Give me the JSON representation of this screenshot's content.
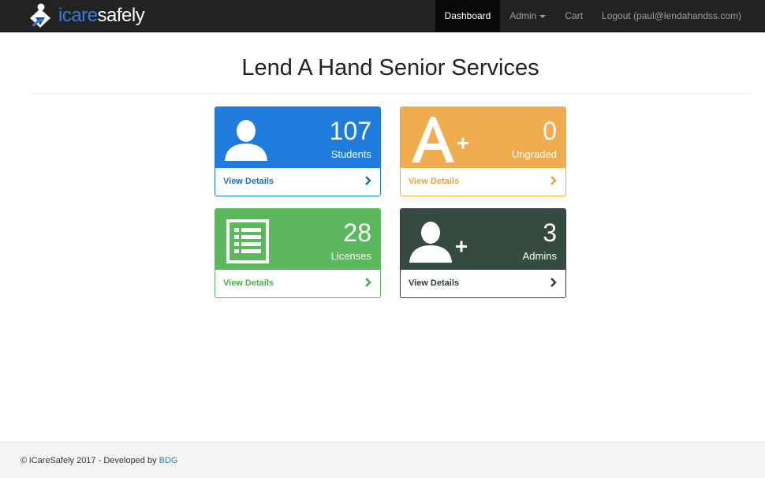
{
  "brand": {
    "name_prefix": "icare",
    "name_suffix": "safely"
  },
  "nav": {
    "dashboard": "Dashboard",
    "admin": "Admin",
    "cart": "Cart",
    "logout": "Logout (paul@lendahandss.com)"
  },
  "page": {
    "title": "Lend A Hand Senior Services"
  },
  "panels": [
    {
      "count": "107",
      "label": "Students",
      "link": "View Details",
      "icon": "user-icon"
    },
    {
      "count": "0",
      "label": "Ungraded",
      "link": "View Details",
      "icon": "grade-a-plus-icon"
    },
    {
      "count": "28",
      "label": "Licenses",
      "link": "View Details",
      "icon": "list-icon"
    },
    {
      "count": "3",
      "label": "Admins",
      "link": "View Details",
      "icon": "add-user-icon"
    }
  ],
  "colors": {
    "blue": "#1f7bdc",
    "orange": "#f0ad4e",
    "green": "#5cb85c",
    "dark": "#364b3f"
  },
  "footer": {
    "copyright": "© iCareSafely 2017 - Developed by ",
    "developer": "BDG"
  }
}
